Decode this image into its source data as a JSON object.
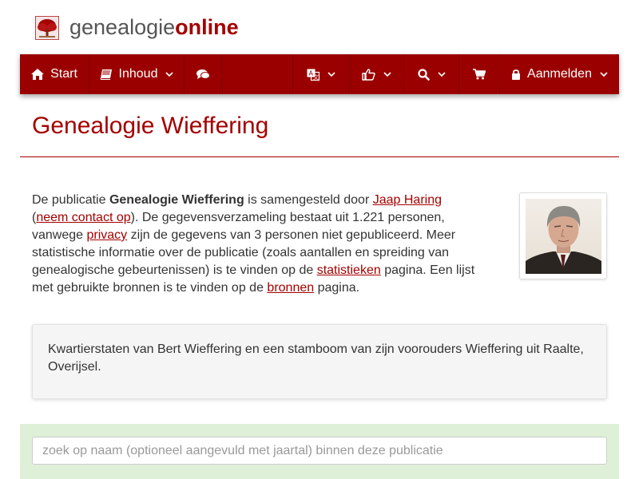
{
  "header": {
    "logo_part1": "genealogie",
    "logo_part2": "online",
    "brand_color": "#a40000"
  },
  "navbar": {
    "background": "#9b0000",
    "start_label": "Start",
    "contents_label": "Inhoud",
    "login_label": "Aanmelden",
    "icons": [
      "home-icon",
      "book-icon",
      "chevron-down-icon",
      "comments-icon",
      "language-icon",
      "thumbs-up-icon",
      "search-icon",
      "cart-icon",
      "lock-icon"
    ]
  },
  "page": {
    "title": "Genealogie Wieffering"
  },
  "intro": {
    "t1": "De publicatie ",
    "pub_name": "Genealogie Wieffering",
    "t2": " is samengesteld door ",
    "author_link": "Jaap Haring",
    "t3": "(",
    "contact_link": "neem contact op",
    "t4": "). De gegevensverzameling bestaat uit 1.221 personen, vanwege ",
    "privacy_link": "privacy",
    "t5": " zijn de gegevens van 3 personen niet gepubliceerd. Meer statistische informatie over de publicatie (zoals aantallen en spreiding van genealogische gebeurtenissen) is te vinden op de ",
    "stats_link": "statistieken",
    "t6": " pagina. Een lijst met gebruikte bronnen is te vinden op de ",
    "sources_link": "bronnen",
    "t7": " pagina."
  },
  "description": {
    "text": "Kwartierstaten van Bert Wieffering en een stamboom van zijn voorouders Wieffering uit Raalte, Overijsel."
  },
  "search": {
    "placeholder": "zoek op naam (optioneel aangevuld met jaartal) binnen deze publicatie",
    "value": ""
  }
}
